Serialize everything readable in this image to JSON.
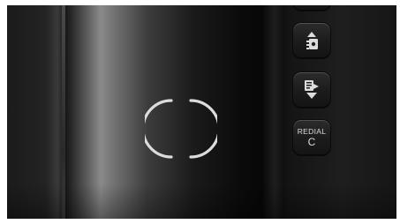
{
  "device": {
    "keys": [
      {
        "name": "key-top-partial"
      },
      {
        "name": "key-contact-up",
        "icon": "contact-book-up-arrow-icon"
      },
      {
        "name": "key-transfer-down",
        "icon": "transfer-down-arrow-icon"
      },
      {
        "name": "key-redial",
        "line1": "REDIAL",
        "line2": "C"
      }
    ],
    "ring_icon": "power-ring-icon",
    "colors": {
      "body": "#161616",
      "highlight": "#8a8a8a",
      "ring": "#dcdcdc",
      "key_text": "#d9d9d9"
    }
  }
}
